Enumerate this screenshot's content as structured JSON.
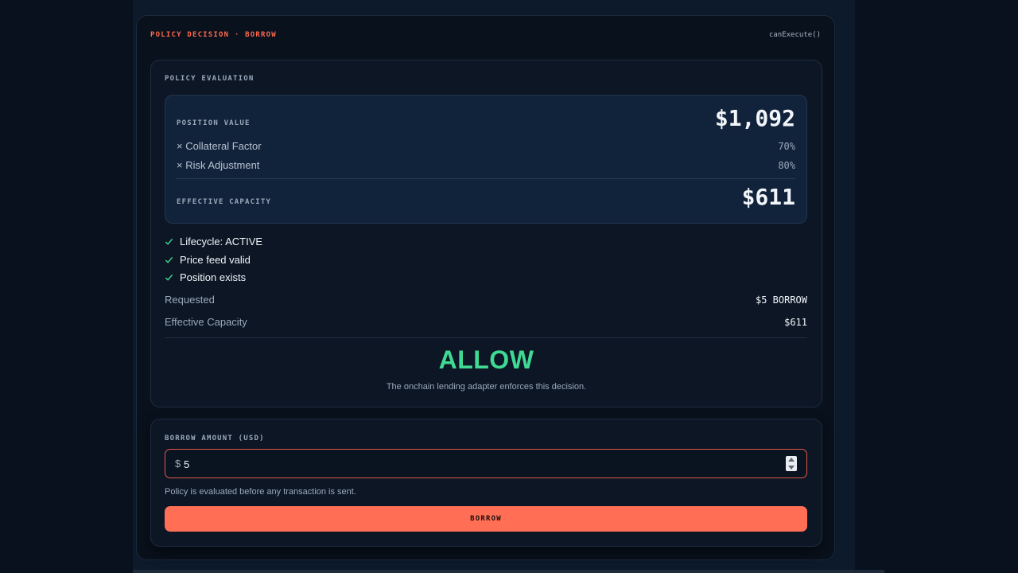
{
  "header": {
    "title": "POLICY DECISION · BORROW",
    "function": "canExecute()"
  },
  "evaluation": {
    "label": "POLICY EVALUATION",
    "position_value_label": "POSITION VALUE",
    "position_value": "$1,092",
    "collateral_factor_label": "× Collateral Factor",
    "collateral_factor": "70%",
    "risk_adjustment_label": "× Risk Adjustment",
    "risk_adjustment": "80%",
    "effective_capacity_label": "EFFECTIVE CAPACITY",
    "effective_capacity": "$611",
    "checks": [
      {
        "label": "Lifecycle: ACTIVE"
      },
      {
        "label": "Price feed valid"
      },
      {
        "label": "Position exists"
      }
    ],
    "requested_label": "Requested",
    "requested_value": "$5 BORROW",
    "capacity_label": "Effective Capacity",
    "capacity_value": "$611",
    "decision": "ALLOW",
    "decision_note": "The onchain lending adapter enforces this decision."
  },
  "borrow": {
    "label": "BORROW AMOUNT (USD)",
    "currency_symbol": "$",
    "amount": "5",
    "hint": "Policy is evaluated before any transaction is sent.",
    "button_label": "BORROW"
  },
  "colors": {
    "accent": "#ff6e55",
    "allow": "#3fd993",
    "check": "#3fd993"
  }
}
